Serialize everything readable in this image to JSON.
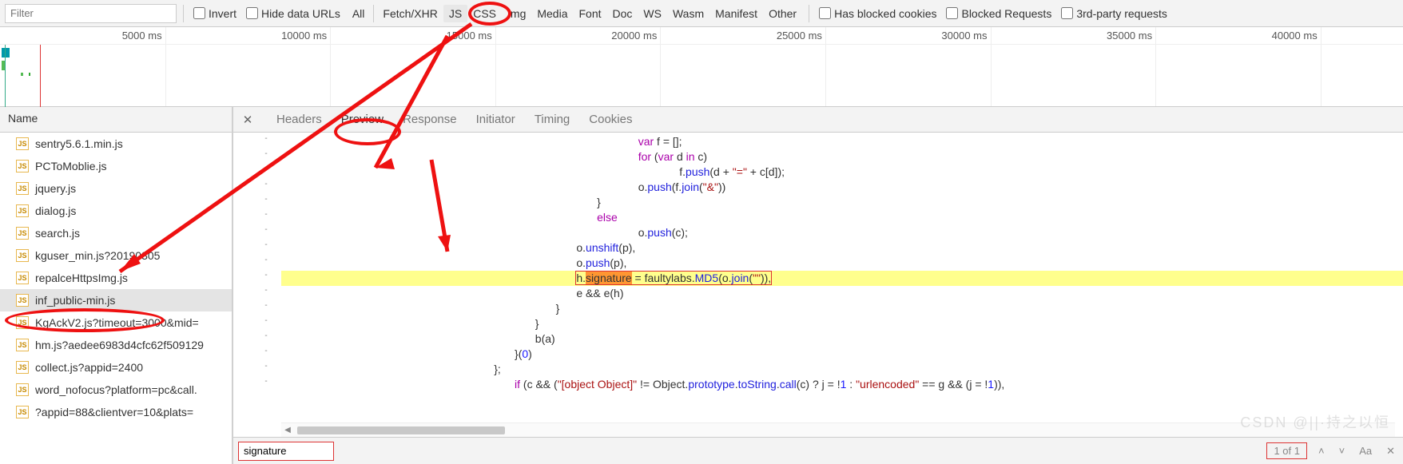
{
  "toolbar": {
    "filter_placeholder": "Filter",
    "invert": "Invert",
    "hide_urls": "Hide data URLs",
    "types": [
      "All",
      "Fetch/XHR",
      "JS",
      "CSS",
      "Img",
      "Media",
      "Font",
      "Doc",
      "WS",
      "Wasm",
      "Manifest",
      "Other"
    ],
    "selected_type": "JS",
    "blocked_cookies": "Has blocked cookies",
    "blocked_requests": "Blocked Requests",
    "third_party": "3rd-party requests"
  },
  "timeline": {
    "ticks": [
      "5000 ms",
      "10000 ms",
      "15000 ms",
      "20000 ms",
      "25000 ms",
      "30000 ms",
      "35000 ms",
      "40000 ms"
    ]
  },
  "left": {
    "header": "Name",
    "files": [
      "sentry5.6.1.min.js",
      "PCToMoblie.js",
      "jquery.js",
      "dialog.js",
      "search.js",
      "kguser_min.js?20190305",
      "repalceHttpsImg.js",
      "inf_public-min.js",
      "KgAckV2.js?timeout=3000&mid=",
      "hm.js?aedee6983d4cfc62f509129",
      "collect.js?appid=2400",
      "word_nofocus?platform=pc&call.",
      "?appid=88&clientver=10&plats="
    ],
    "selected_index": 7
  },
  "detail": {
    "tabs": [
      "Headers",
      "Preview",
      "Response",
      "Initiator",
      "Timing",
      "Cookies"
    ],
    "active_tab": "Preview"
  },
  "code": {
    "lines": [
      {
        "indent": 15,
        "html": "<span class='kw'>var</span> f = [];"
      },
      {
        "indent": 15,
        "html": "<span class='kw'>for</span> (<span class='kw'>var</span> d <span class='kw'>in</span> c)"
      },
      {
        "indent": 17,
        "html": "f.<span class='prop'>push</span>(d + <span class='str'>\"=\"</span> + c[d]);"
      },
      {
        "indent": 15,
        "html": "o.<span class='prop'>push</span>(f.<span class='prop'>join</span>(<span class='str'>\"&\"</span>))"
      },
      {
        "indent": 13,
        "html": "}"
      },
      {
        "indent": 13,
        "html": "<span class='kw'>else</span>"
      },
      {
        "indent": 15,
        "html": "o.<span class='prop'>push</span>(c);"
      },
      {
        "indent": 12,
        "html": "o.<span class='prop'>unshift</span>(p),"
      },
      {
        "indent": 12,
        "html": "o.<span class='prop'>push</span>(p),"
      },
      {
        "indent": 12,
        "html": "<span class='match-box'>h.<span class='match-hl'>signature</span> = faultylabs.<span class='prop'>MD5</span>(o.<span class='prop'>join</span>(<span class='str'>\"\"</span>)),</span>",
        "hl": true
      },
      {
        "indent": 12,
        "html": "e && e(h)"
      },
      {
        "indent": 11,
        "html": "}"
      },
      {
        "indent": 10,
        "html": "}"
      },
      {
        "indent": 10,
        "html": "b(a)"
      },
      {
        "indent": 9,
        "html": "}(<span class='num'>0</span>)"
      },
      {
        "indent": 8,
        "html": "};"
      },
      {
        "indent": 9,
        "html": "<span class='kw'>if</span> (c && (<span class='str'>\"[object Object]\"</span> != Object.<span class='prop'>prototype</span>.<span class='prop'>toString</span>.<span class='prop'>call</span>(c) ? j = !<span class='num'>1</span> : <span class='str'>\"urlencoded\"</span> == g && (j = !<span class='num'>1</span>)),"
      }
    ]
  },
  "search": {
    "value": "signature",
    "count": "1 of 1",
    "case_label": "Aa",
    "close_label": "✕"
  },
  "watermark": "CSDN @||·持之以恒"
}
